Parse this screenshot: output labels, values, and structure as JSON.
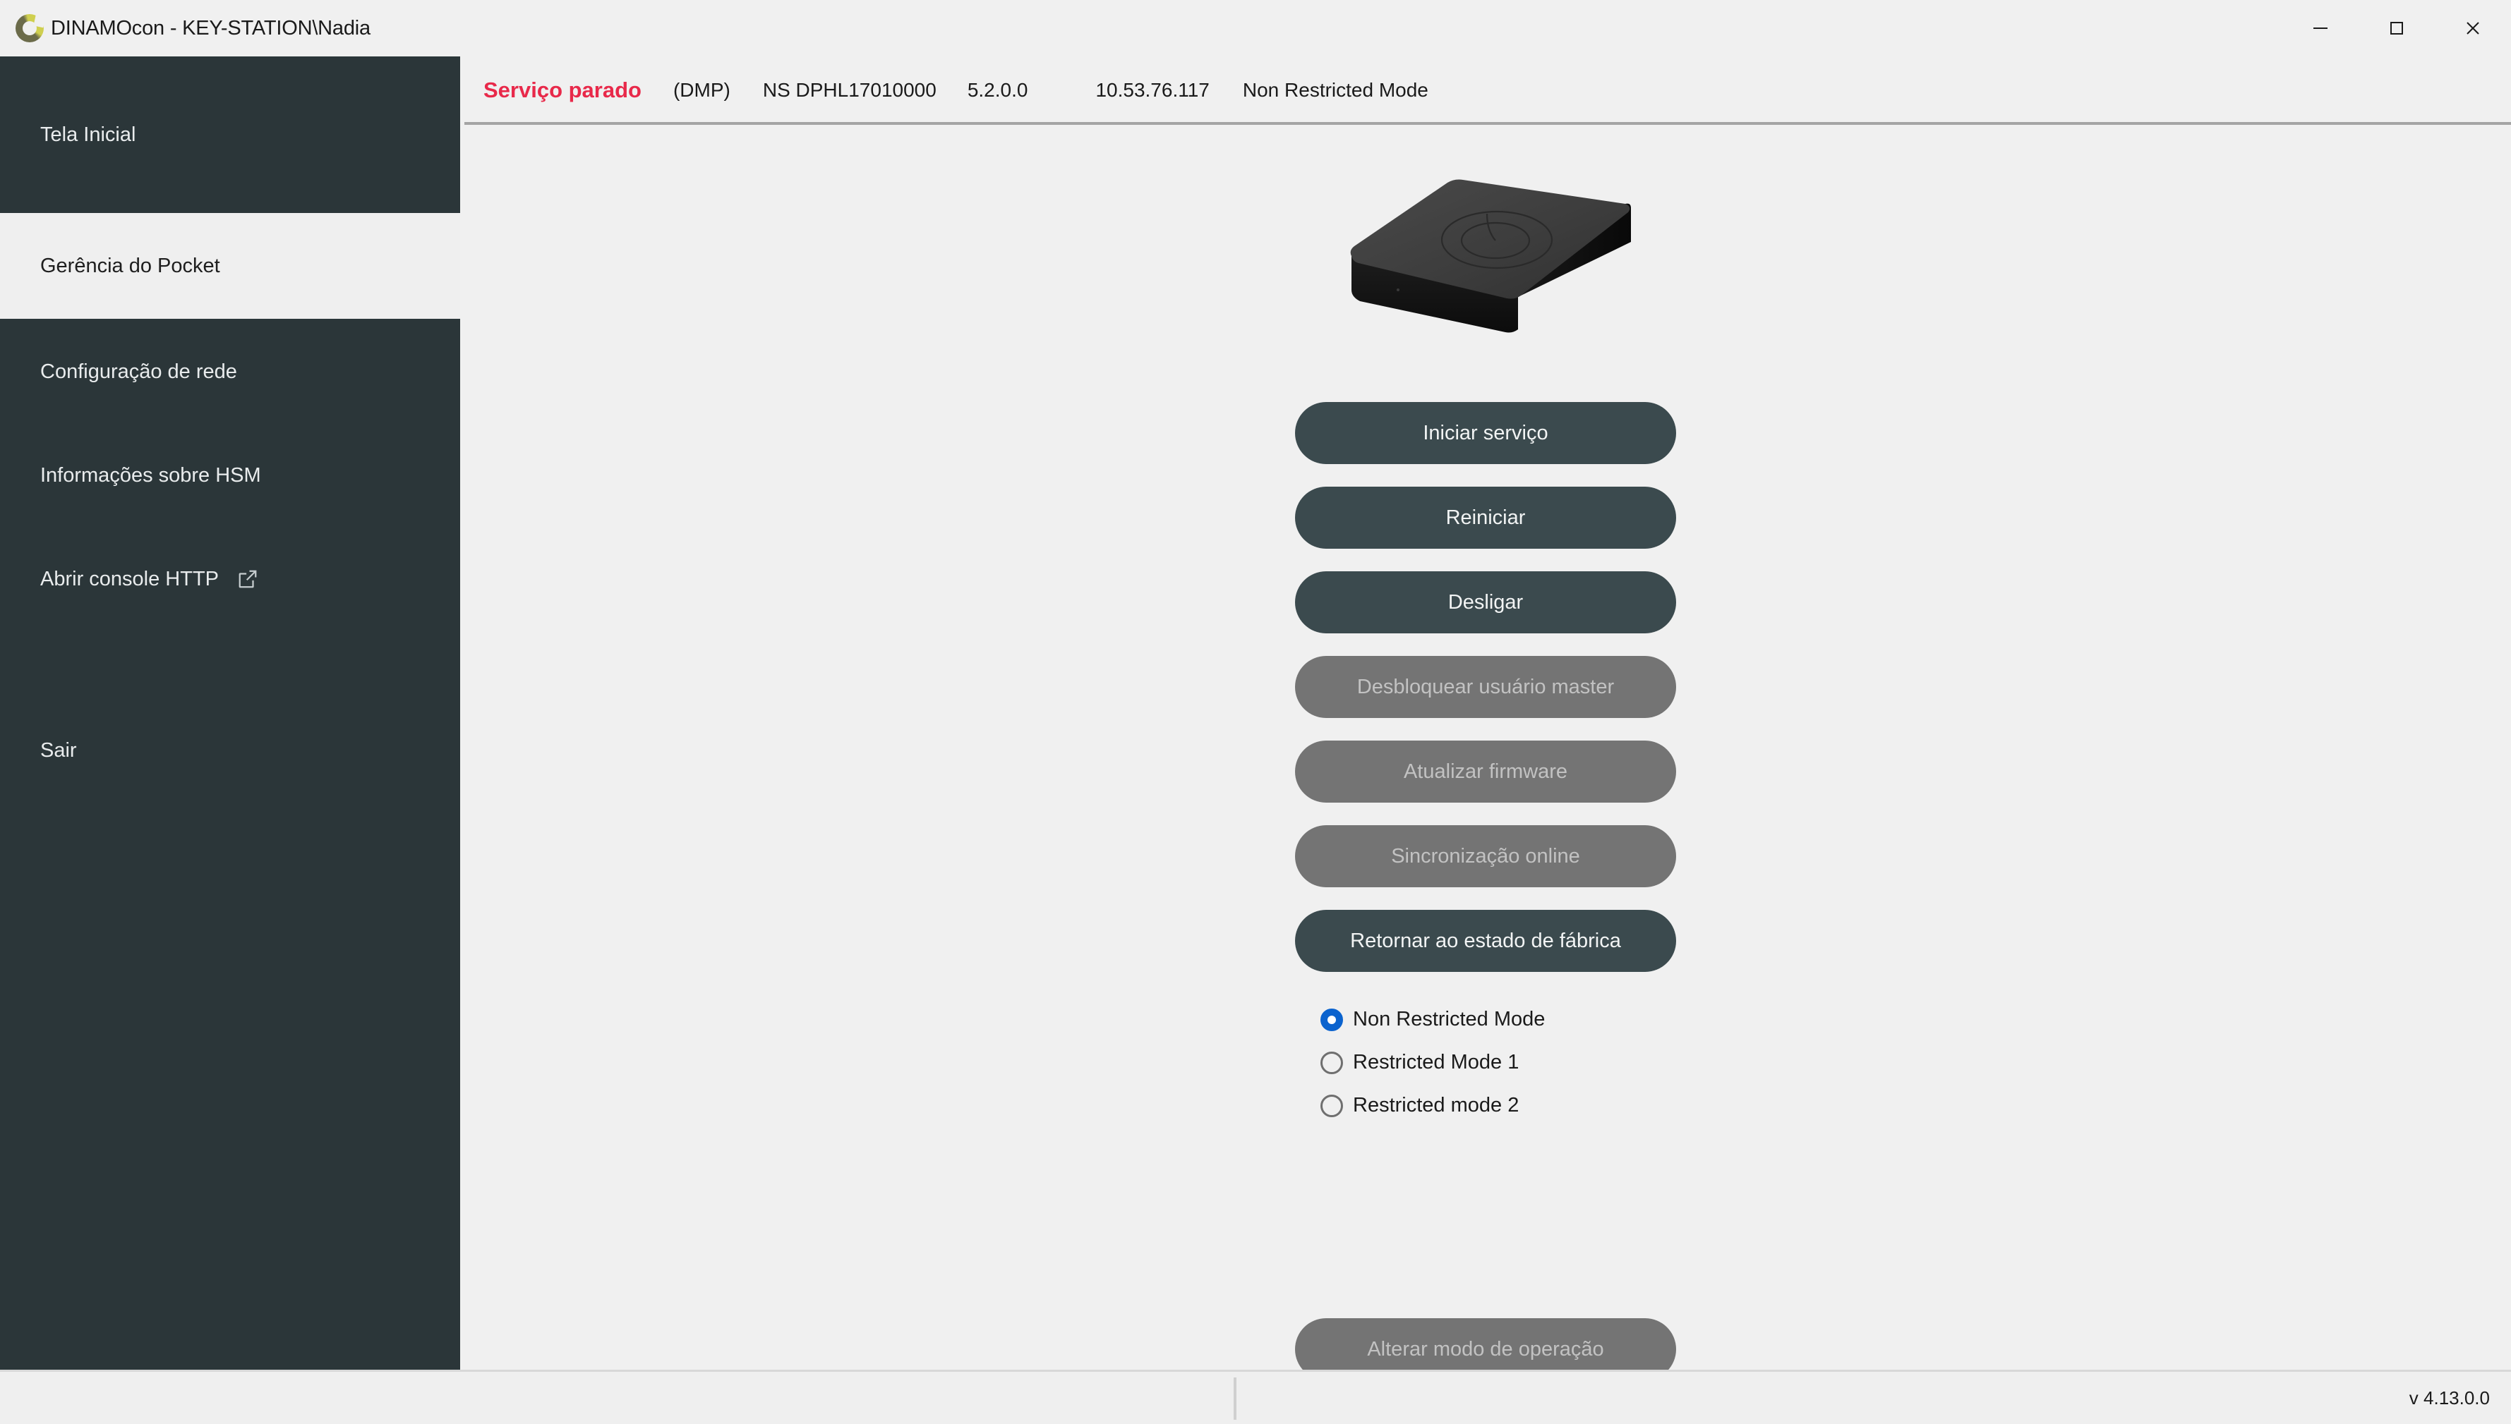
{
  "window": {
    "title": "DINAMOcon - KEY-STATION\\Nadia",
    "logo_icon": "dinamo-ring-logo",
    "controls": {
      "minimize": "minimize-icon",
      "maximize": "maximize-icon",
      "close": "close-icon"
    }
  },
  "colors": {
    "sidebar_bg": "#2b3639",
    "page_bg": "#f0f0f0",
    "accent_button": "#3b4a4e",
    "disabled_button": "#747474",
    "status_error": "#e8294a",
    "radio_selected": "#0b63ce",
    "logo_light": "#cfcf4f",
    "logo_dark": "#6b6b4a"
  },
  "sidebar": {
    "items": [
      {
        "label": "Tela Inicial",
        "selected": false,
        "icon": null
      },
      {
        "label": "Gerência do Pocket",
        "selected": true,
        "icon": null
      },
      {
        "label": "Configuração de rede",
        "selected": false,
        "icon": null
      },
      {
        "label": "Informações sobre HSM",
        "selected": false,
        "icon": null
      },
      {
        "label": "Abrir console HTTP",
        "selected": false,
        "icon": "external-link-icon"
      },
      {
        "label": "Sair",
        "selected": false,
        "icon": null
      }
    ]
  },
  "header": {
    "service_status": "Serviço parado",
    "model": "(DMP)",
    "serial": "NS DPHL17010000",
    "firmware_version": "5.2.0.0",
    "ip_address": "10.53.76.117",
    "operation_mode": "Non Restricted Mode"
  },
  "main": {
    "device_image_alt": "pocket-hsm-device",
    "buttons": [
      {
        "label": "Iniciar serviço",
        "enabled": true
      },
      {
        "label": "Reiniciar",
        "enabled": true
      },
      {
        "label": "Desligar",
        "enabled": true
      },
      {
        "label": "Desbloquear usuário master",
        "enabled": false
      },
      {
        "label": "Atualizar firmware",
        "enabled": false
      },
      {
        "label": "Sincronização online",
        "enabled": false
      },
      {
        "label": "Retornar ao estado de fábrica",
        "enabled": true
      }
    ],
    "modes": [
      {
        "label": "Non Restricted Mode",
        "selected": true
      },
      {
        "label": "Restricted Mode 1",
        "selected": false
      },
      {
        "label": "Restricted mode 2",
        "selected": false
      }
    ],
    "change_mode_button": {
      "label": "Alterar modo de operação",
      "enabled": false
    }
  },
  "statusbar": {
    "version": "v 4.13.0.0"
  }
}
